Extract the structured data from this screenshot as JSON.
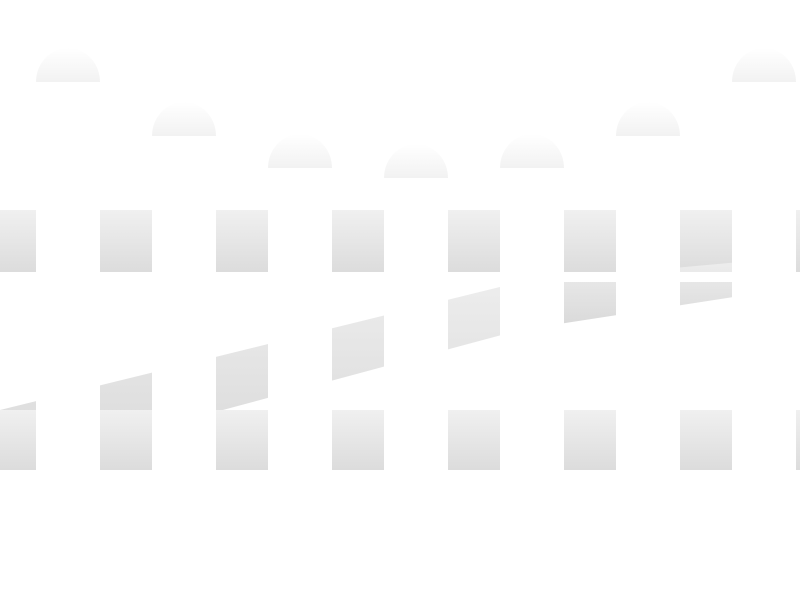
{
  "image": {
    "subject": "white-picket-fence",
    "background_color": "#ffffff",
    "picket_color": "#ffffff",
    "rail_color": "#e6e6e6",
    "shadow_color": "#cfcfcf",
    "picket_count": 7,
    "rail_count": 3
  }
}
